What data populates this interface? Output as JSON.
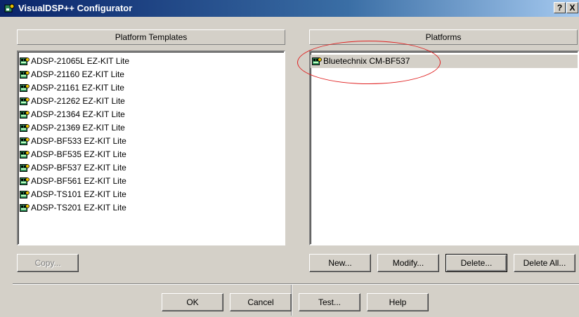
{
  "window": {
    "title": "VisualDSP++ Configurator",
    "help_btn": "?",
    "close_btn": "X"
  },
  "left": {
    "header": "Platform Templates",
    "items": [
      "ADSP-21065L EZ-KIT Lite",
      "ADSP-21160 EZ-KIT Lite",
      "ADSP-21161 EZ-KIT Lite",
      "ADSP-21262 EZ-KIT Lite",
      "ADSP-21364 EZ-KIT Lite",
      "ADSP-21369 EZ-KIT Lite",
      "ADSP-BF533 EZ-KIT Lite",
      "ADSP-BF535 EZ-KIT Lite",
      "ADSP-BF537 EZ-KIT Lite",
      "ADSP-BF561 EZ-KIT Lite",
      "ADSP-TS101 EZ-KIT Lite",
      "ADSP-TS201 EZ-KIT Lite"
    ],
    "copy_btn": "Copy..."
  },
  "right": {
    "header": "Platforms",
    "items": [
      "Bluetechnix CM-BF537"
    ],
    "new_btn": "New...",
    "modify_btn": "Modify...",
    "delete_btn": "Delete...",
    "delete_all_btn": "Delete All..."
  },
  "footer": {
    "ok_btn": "OK",
    "cancel_btn": "Cancel",
    "test_btn": "Test...",
    "help_btn": "Help"
  },
  "colors": {
    "face": "#d4d0c8",
    "title_start": "#0a246a",
    "title_end": "#a6caf0",
    "selection": "#d4d0c8",
    "annotation": "#e02020"
  },
  "icons": {
    "app": "configurator-app-icon",
    "item": "board-icon"
  }
}
